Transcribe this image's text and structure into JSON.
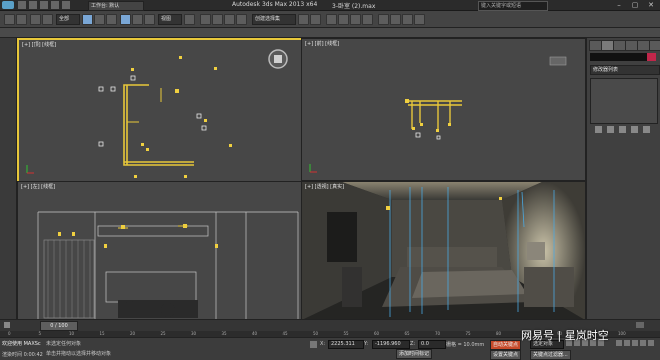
{
  "app": {
    "title": "Autodesk 3ds Max  2013 x64",
    "file": "3-卧室 (2).max",
    "workspace": "工作台: 默认",
    "search_placeholder": "键入关键字或短语"
  },
  "toolbar": {
    "view_dropdown": "视图",
    "selection_set": "创建选择集"
  },
  "viewports": {
    "top": "[+] [顶] [线框]",
    "front": "[+] [前] [线框]",
    "left": "[+] [左] [线框]",
    "perspective": "[+] [透视] [真实]"
  },
  "command_panel": {
    "modifier_list": "修改器列表"
  },
  "timeline": {
    "frame": "0 / 100",
    "ticks": [
      "0",
      "5",
      "10",
      "15",
      "20",
      "25",
      "30",
      "35",
      "40",
      "45",
      "50",
      "55",
      "60",
      "65",
      "70",
      "75",
      "80",
      "85",
      "90",
      "95",
      "100"
    ]
  },
  "status": {
    "welcome": "欢迎使用 MAXSc",
    "selected": "未选定任何对象",
    "hint": "单击并拖动以选择并移动对象",
    "x_label": "X:",
    "x_value": "2225.311",
    "y_label": "Y:",
    "y_value": "-1196.960",
    "z_label": "Z:",
    "z_value": "0.0",
    "grid": "栅格 = 10.0mm",
    "render_time": "渲染时间 0:00:42",
    "auto_key": "自动关键点",
    "set_key": "设置关键点",
    "selected_obj": "选定对象",
    "key_filter": "关键点过滤器...",
    "add_time_tag": "添加时间标记"
  },
  "watermark": "网易号 | 星岚时空"
}
